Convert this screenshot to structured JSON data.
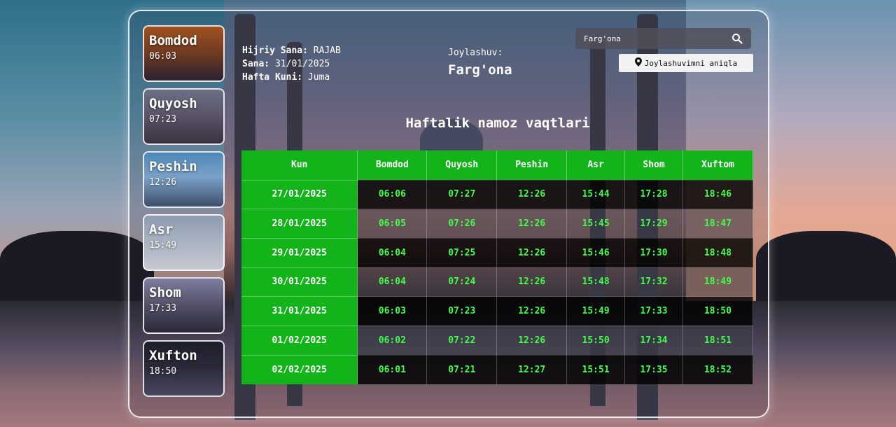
{
  "prayers": [
    {
      "name": "Bomdod",
      "time": "06:03"
    },
    {
      "name": "Quyosh",
      "time": "07:23"
    },
    {
      "name": "Peshin",
      "time": "12:26"
    },
    {
      "name": "Asr",
      "time": "15:49"
    },
    {
      "name": "Shom",
      "time": "17:33"
    },
    {
      "name": "Xufton",
      "time": "18:50"
    }
  ],
  "info": {
    "hijri_label": "Hijriy Sana:",
    "hijri_value": "RAJAB",
    "date_label": "Sana:",
    "date_value": "31/01/2025",
    "weekday_label": "Hafta Kuni:",
    "weekday_value": "Juma"
  },
  "location": {
    "label": "Joylashuv:",
    "value": "Farg'ona"
  },
  "search": {
    "value": "Farg'ona",
    "icon": "search-icon"
  },
  "locate_button": {
    "label": "Joylashuvimni aniqla",
    "icon": "map-marker-icon"
  },
  "weekly": {
    "title": "Haftalik namoz vaqtlari",
    "headers": [
      "Kun",
      "Bomdod",
      "Quyosh",
      "Peshin",
      "Asr",
      "Shom",
      "Xuftom"
    ],
    "rows": [
      [
        "27/01/2025",
        "06:06",
        "07:27",
        "12:26",
        "15:44",
        "17:28",
        "18:46"
      ],
      [
        "28/01/2025",
        "06:05",
        "07:26",
        "12:26",
        "15:45",
        "17:29",
        "18:47"
      ],
      [
        "29/01/2025",
        "06:04",
        "07:25",
        "12:26",
        "15:46",
        "17:30",
        "18:48"
      ],
      [
        "30/01/2025",
        "06:04",
        "07:24",
        "12:26",
        "15:48",
        "17:32",
        "18:49"
      ],
      [
        "31/01/2025",
        "06:03",
        "07:23",
        "12:26",
        "15:49",
        "17:33",
        "18:50"
      ],
      [
        "01/02/2025",
        "06:02",
        "07:22",
        "12:26",
        "15:50",
        "17:34",
        "18:51"
      ],
      [
        "02/02/2025",
        "06:01",
        "07:21",
        "12:27",
        "15:51",
        "17:35",
        "18:52"
      ]
    ]
  }
}
